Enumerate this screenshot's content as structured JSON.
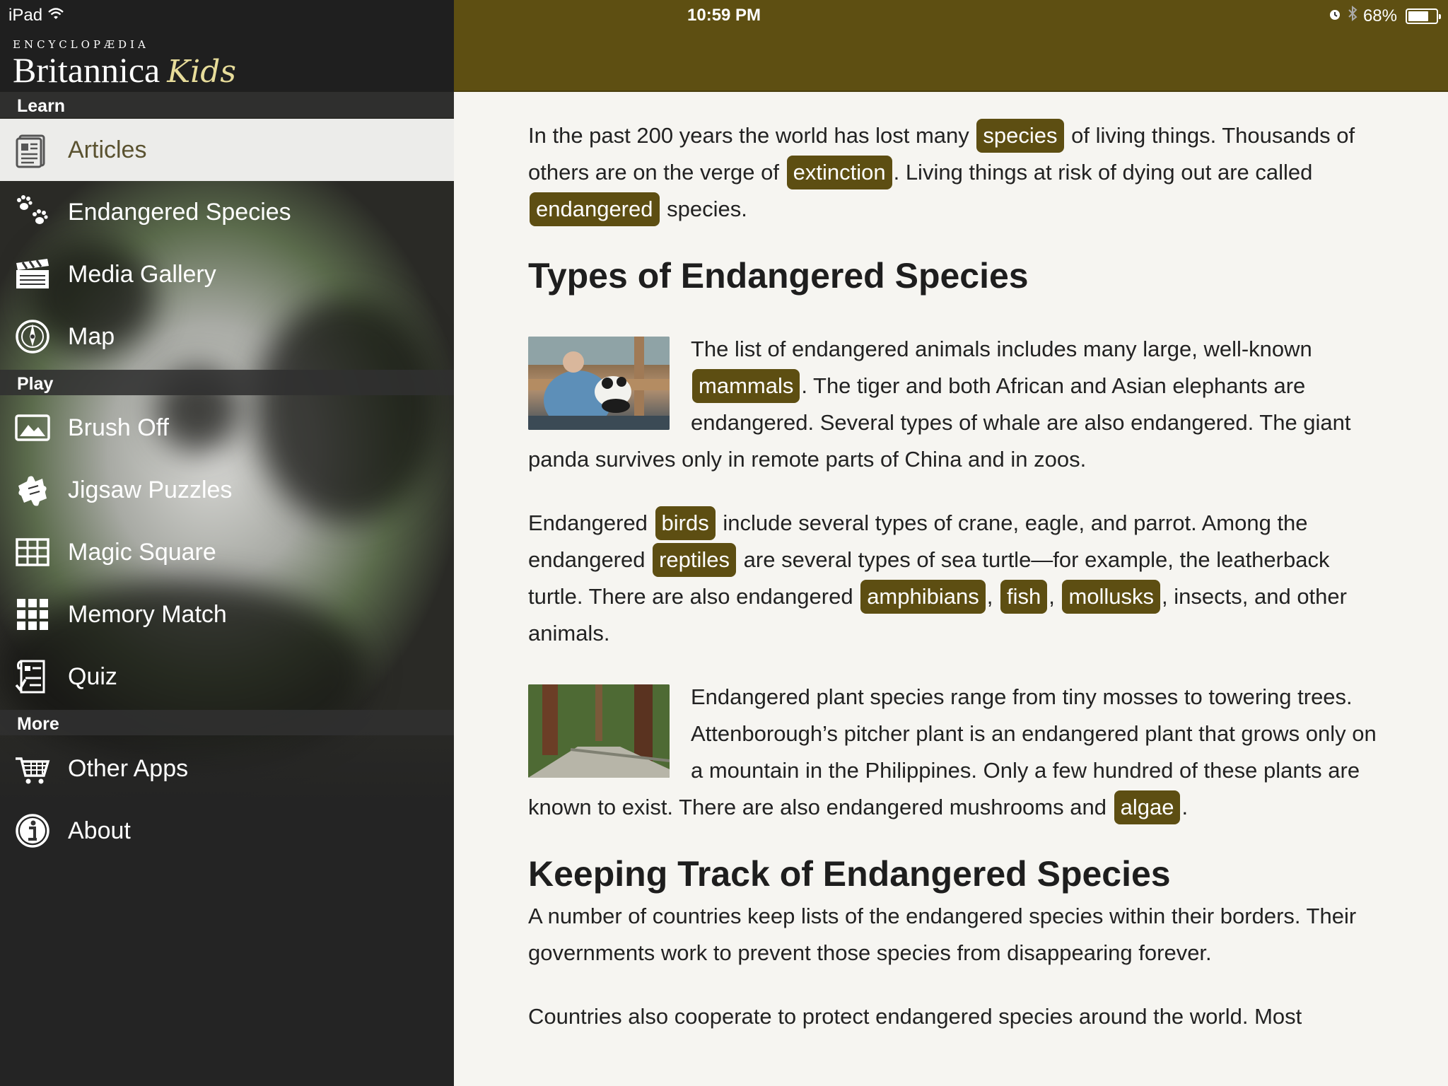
{
  "status": {
    "device": "iPad",
    "time": "10:59 PM",
    "battery": "68%"
  },
  "logo": {
    "top": "ENCYCLOPÆDIA",
    "main": "Britannica",
    "kids": "Kids"
  },
  "sidebar": {
    "sections": [
      {
        "label": "Learn"
      },
      {
        "label": "Play"
      },
      {
        "label": "More"
      }
    ],
    "items": [
      {
        "label": "Articles",
        "icon": "article-icon"
      },
      {
        "label": "Endangered Species",
        "icon": "paw-prints-icon"
      },
      {
        "label": "Media Gallery",
        "icon": "clapperboard-icon"
      },
      {
        "label": "Map",
        "icon": "compass-icon"
      },
      {
        "label": "Brush Off",
        "icon": "picture-icon"
      },
      {
        "label": "Jigsaw Puzzles",
        "icon": "puzzle-icon"
      },
      {
        "label": "Magic Square",
        "icon": "grid-icon"
      },
      {
        "label": "Memory Match",
        "icon": "tiles-icon"
      },
      {
        "label": "Quiz",
        "icon": "quiz-icon"
      },
      {
        "label": "Other Apps",
        "icon": "cart-icon"
      },
      {
        "label": "About",
        "icon": "info-icon"
      }
    ]
  },
  "article": {
    "p1": {
      "a": "In the past 200 years the world has lost many ",
      "t1": "species",
      "b": " of living things. Thousands of others are on the verge of ",
      "t2": "extinction",
      "c": ". Living things at risk of dying out are called ",
      "t3": "endangered",
      "d": " species."
    },
    "h1": "Types of Endangered Species",
    "p2": {
      "a": "The list of endangered animals includes many large, well-known ",
      "t1": "mammals",
      "b": ". The tiger and both African and Asian elephants are endangered. Several types of whale are also endangered. The giant panda survives only in remote parts of China and in zoos."
    },
    "p3": {
      "a": "Endangered ",
      "t1": "birds",
      "b": " include several types of crane, eagle, and parrot. Among the endangered ",
      "t2": "reptiles",
      "c": " are several types of sea turtle—for example, the leatherback turtle. There are also endangered ",
      "t3": "amphibians",
      "d": ", ",
      "t4": "fish",
      "e": ", ",
      "t5": "mollusks",
      "f": ", insects, and other animals."
    },
    "p4": {
      "a": "Endangered plant species range from tiny mosses to towering trees. Attenborough’s pitcher plant is an endangered plant that grows only on a mountain in the Philippines. Only a few hundred of these plants are known to exist. There are also endangered mushrooms and ",
      "t1": "algae",
      "b": "."
    },
    "h2": "Keeping Track of Endangered Species",
    "p5": "A number of countries keep lists of the endangered species within their borders. Their governments work to prevent those species from disappearing forever.",
    "p6": "Countries also cooperate to protect endangered species around the world. Most"
  },
  "colors": {
    "accent": "#5e4f12",
    "tag": "#5d4e12",
    "content_bg": "#f6f5f1",
    "sidebar_active": "#ececea"
  }
}
